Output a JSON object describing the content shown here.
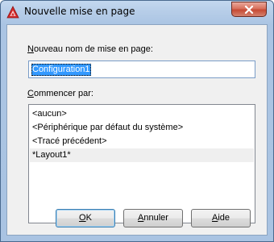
{
  "window": {
    "title": "Nouvelle mise en page",
    "icon": "autocad-logo-icon",
    "close_icon": "close-icon"
  },
  "form": {
    "name_label_accel": "N",
    "name_label_rest": "ouveau nom de mise en page:",
    "name_value": "Configuration1",
    "start_label_accel": "C",
    "start_label_rest": "ommencer par:"
  },
  "start_list": {
    "items": [
      "<aucun>",
      "<Périphérique par défaut du système>",
      "<Tracé précédent>",
      "*Layout1*"
    ],
    "selected_index": 3
  },
  "buttons": {
    "ok_accel": "O",
    "ok_rest": "K",
    "cancel_accel": "A",
    "cancel_rest": "nnuler",
    "help_accel": "A",
    "help_rest": "ide"
  },
  "colors": {
    "selection": "#3399ff",
    "close_button": "#c64a34",
    "logo": "#d42a2a"
  }
}
